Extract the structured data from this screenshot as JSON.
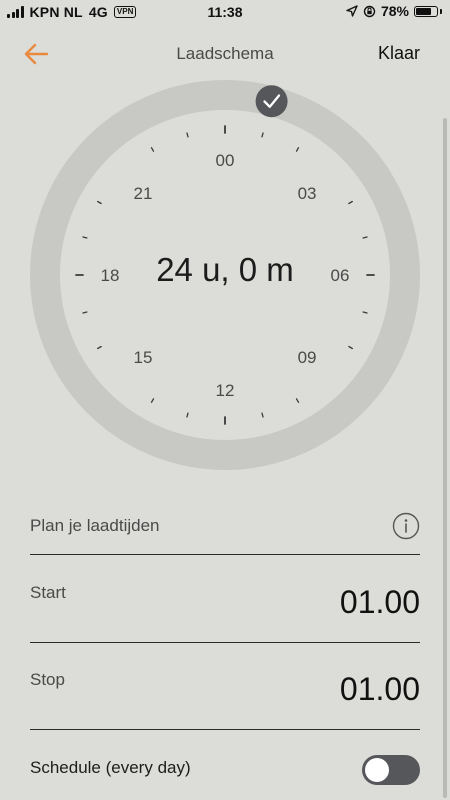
{
  "status_bar": {
    "carrier": "KPN NL",
    "network": "4G",
    "vpn": "VPN",
    "time": "11:38",
    "battery": "78%",
    "battery_level": 0.78
  },
  "nav": {
    "title": "Laadschema",
    "done_label": "Klaar"
  },
  "dial": {
    "duration": "24 u, 0 m",
    "hour_labels": [
      "00",
      "03",
      "06",
      "09",
      "12",
      "15",
      "18",
      "21"
    ]
  },
  "plan": {
    "label": "Plan je laadtijden"
  },
  "start": {
    "label": "Start",
    "value": "01.00"
  },
  "stop": {
    "label": "Stop",
    "value": "01.00"
  },
  "schedule": {
    "label": "Schedule (every day)",
    "enabled": false
  },
  "colors": {
    "accent": "#e8893d",
    "background": "#dcdcd8",
    "ring": "#c8c8c5",
    "handle": "#55575b"
  }
}
